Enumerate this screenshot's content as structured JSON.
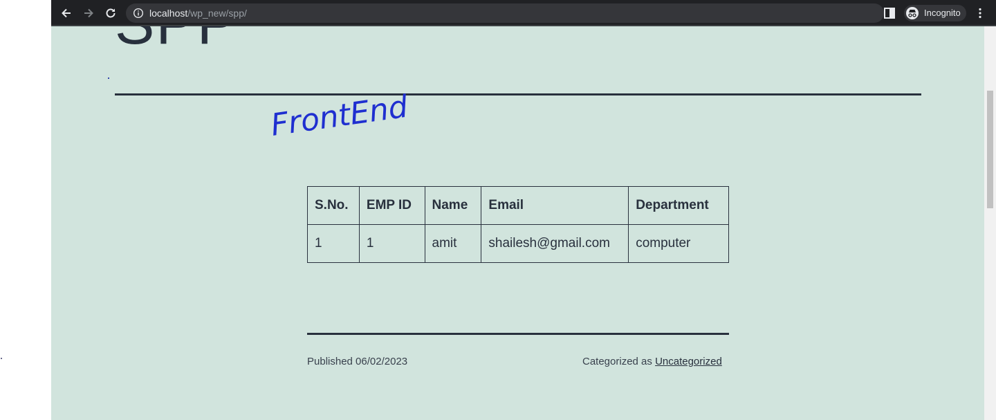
{
  "browser": {
    "url_host": "localhost",
    "url_path": "/wp_new/spp/",
    "incognito_label": "Incognito"
  },
  "page": {
    "title": "SPP",
    "handwritten_note": "FrontEnd",
    "table": {
      "headers": [
        "S.No.",
        "EMP ID",
        "Name",
        "Email",
        "Department"
      ],
      "rows": [
        [
          "1",
          "1",
          "amit",
          "shailesh@gmail.com",
          "computer"
        ]
      ]
    },
    "footer": {
      "published": "Published 06/02/2023",
      "categorized_prefix": "Categorized as ",
      "category": "Uncategorized"
    }
  },
  "colors": {
    "page_background": "#d1e4dd",
    "text": "#28303d",
    "toolbar": "#202124",
    "handwriting_ink": "#1f2fd0"
  },
  "icons": [
    "back-icon",
    "forward-icon",
    "reload-icon",
    "info-icon",
    "star-icon",
    "side-panel-icon",
    "incognito-icon",
    "more-menu-icon"
  ]
}
